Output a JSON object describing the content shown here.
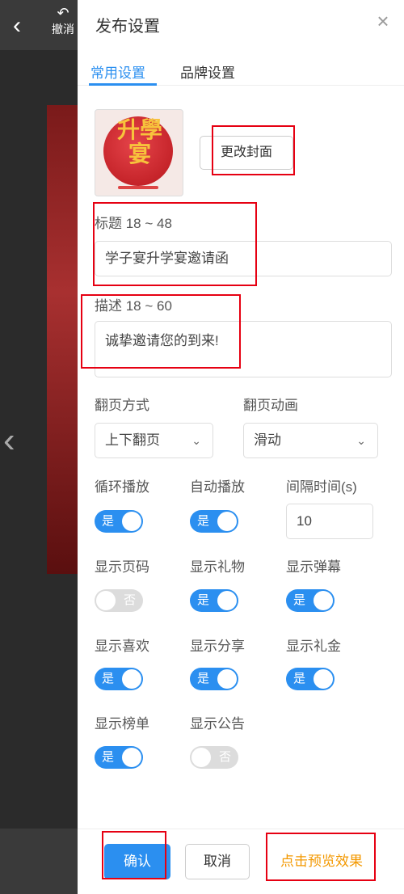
{
  "background": {
    "undo_label": "撤消"
  },
  "panel": {
    "title": "发布设置",
    "tabs": [
      {
        "label": "常用设置",
        "active": true
      },
      {
        "label": "品牌设置",
        "active": false
      }
    ],
    "cover": {
      "image_text": "升學宴",
      "change_button": "更改封面"
    },
    "title_field": {
      "label": "标题 18 ~ 48",
      "value": "学子宴升学宴邀请函"
    },
    "description_field": {
      "label": "描述 18 ~ 60",
      "value": "诚挚邀请您的到来!"
    },
    "page_turn_mode": {
      "label": "翻页方式",
      "value": "上下翻页"
    },
    "page_turn_animation": {
      "label": "翻页动画",
      "value": "滑动"
    },
    "toggles": [
      {
        "label": "循环播放",
        "on": true,
        "text": "是"
      },
      {
        "label": "自动播放",
        "on": true,
        "text": "是"
      },
      {
        "label": "显示页码",
        "on": false,
        "text": "否"
      },
      {
        "label": "显示礼物",
        "on": true,
        "text": "是"
      },
      {
        "label": "显示弹幕",
        "on": true,
        "text": "是"
      },
      {
        "label": "显示喜欢",
        "on": true,
        "text": "是"
      },
      {
        "label": "显示分享",
        "on": true,
        "text": "是"
      },
      {
        "label": "显示礼金",
        "on": true,
        "text": "是"
      },
      {
        "label": "显示榜单",
        "on": true,
        "text": "是"
      },
      {
        "label": "显示公告",
        "on": false,
        "text": "否"
      }
    ],
    "interval": {
      "label": "间隔时间(s)",
      "value": "10"
    },
    "footer": {
      "confirm": "确认",
      "cancel": "取消",
      "preview": "点击预览效果"
    }
  },
  "colors": {
    "accent": "#2b8ff0",
    "preview": "#f39800",
    "annotation": "#e60012"
  }
}
